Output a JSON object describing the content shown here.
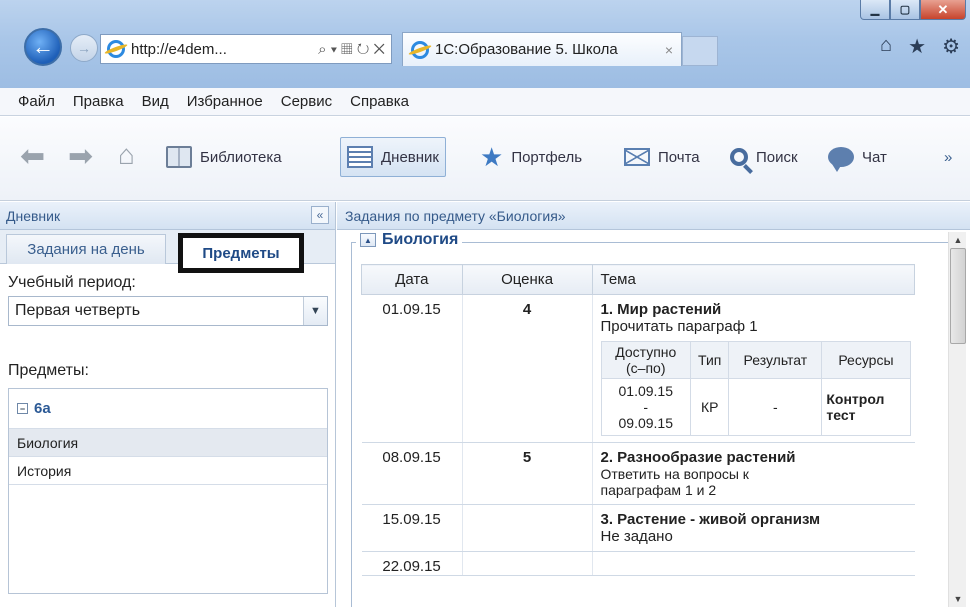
{
  "browser": {
    "address": "http://e4dem...",
    "address_actions": "⌕ ▾ ▦ ↻ ✕",
    "tab_title": "1С:Образование 5. Школа",
    "tab_close": "×",
    "back_icon": "back-arrow",
    "forward_icon": "forward-arrow",
    "right_icons": [
      "home-icon",
      "favorites-star-icon",
      "settings-gear-icon"
    ]
  },
  "menu": [
    "Файл",
    "Правка",
    "Вид",
    "Избранное",
    "Сервис",
    "Справка"
  ],
  "toolbar": {
    "library": "Библиотека",
    "diary": "Дневник",
    "portfolio": "Портфель",
    "mail": "Почта",
    "search": "Поиск",
    "chat": "Чат",
    "more": "»"
  },
  "left_panel": {
    "header": "Дневник",
    "collapse": "«",
    "tab_day": "Задания на день",
    "tab_subjects": "Предметы",
    "period_label": "Учебный период:",
    "period_value": "Первая четверть",
    "subjects_label": "Предметы:",
    "group": "6а",
    "subjects": [
      "Биология",
      "История"
    ]
  },
  "right_panel": {
    "header": "Задания по предмету «Биология»",
    "section": "Биология",
    "columns": {
      "date": "Дата",
      "grade": "Оценка",
      "topic": "Тема"
    },
    "rows": [
      {
        "date": "01.09.15",
        "grade": "4",
        "title": "1. Мир растений",
        "desc": "Прочитать параграф 1"
      },
      {
        "date": "08.09.15",
        "grade": "5",
        "title": "2. Разнообразие растений",
        "desc1": "Ответить на вопросы к",
        "desc2": "параграфам 1 и 2"
      },
      {
        "date": "15.09.15",
        "grade": "",
        "title": "3. Растение - живой организм",
        "desc": "Не задано"
      },
      {
        "date": "22.09.15"
      }
    ],
    "sub_columns": {
      "available1": "Доступно",
      "available2": "(с–по)",
      "type": "Тип",
      "result": "Результат",
      "resources": "Ресурсы"
    },
    "sub_row": {
      "from": "01.09.15",
      "dash": "-",
      "to": "09.09.15",
      "type": "КР",
      "result": "-",
      "res1": "Контрол",
      "res2": "тест"
    }
  },
  "colors": {
    "accent": "#1f4a86",
    "header_bg": "#d4e2f2",
    "close_red": "#c7442c"
  }
}
